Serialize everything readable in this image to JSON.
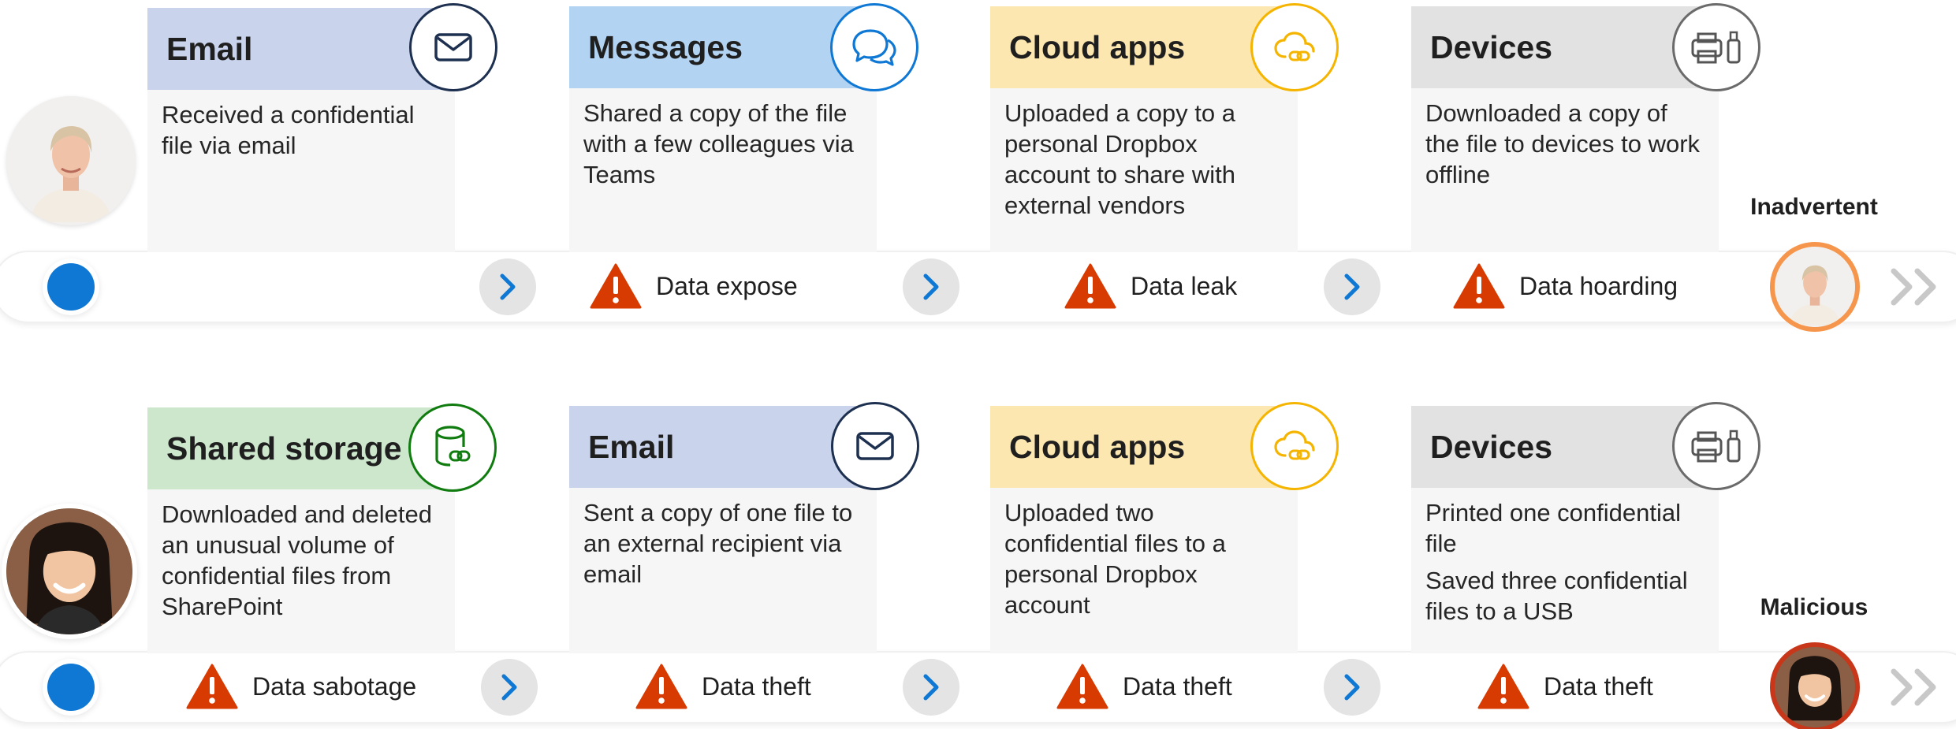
{
  "colors": {
    "email": "#c9d4ec",
    "messages": "#b3d3f2",
    "cloud": "#fde7b0",
    "devices": "#e2e2e2",
    "storage": "#cde7cd",
    "blue": "#0f78d4",
    "warning": "#d83b01",
    "inadvertent_ring": "#f6964d",
    "malicious_ring": "#c8371a"
  },
  "rows": [
    {
      "persona_label": "Inadvertent",
      "steps": [
        {
          "title": "Email",
          "icon": "envelope-icon",
          "lines": [
            "Received a confidential file via email"
          ]
        },
        {
          "title": "Messages",
          "icon": "chat-bubbles-icon",
          "lines": [
            "Shared a copy of the file with a few colleagues via Teams"
          ]
        },
        {
          "title": "Cloud apps",
          "icon": "cloud-link-icon",
          "lines": [
            "Uploaded a copy to a personal Dropbox account to share with external vendors"
          ]
        },
        {
          "title": "Devices",
          "icon": "printer-usb-icon",
          "lines": [
            "Downloaded a copy of the file to devices to work offline"
          ]
        }
      ],
      "risks": [
        "Data expose",
        "Data leak",
        "Data hoarding"
      ]
    },
    {
      "persona_label": "Malicious",
      "steps": [
        {
          "title": "Shared storage",
          "icon": "database-link-icon",
          "lines": [
            "Downloaded and deleted an unusual volume of confidential files from SharePoint"
          ]
        },
        {
          "title": "Email",
          "icon": "envelope-icon",
          "lines": [
            "Sent a copy of one file to an external recipient via email"
          ]
        },
        {
          "title": "Cloud apps",
          "icon": "cloud-link-icon",
          "lines": [
            "Uploaded two confidential files to a personal Dropbox account"
          ]
        },
        {
          "title": "Devices",
          "icon": "printer-usb-icon",
          "lines": [
            "Printed one confidential file",
            "Saved three confidential files to a USB"
          ]
        }
      ],
      "risks": [
        "Data sabotage",
        "Data theft",
        "Data theft",
        "Data theft"
      ]
    }
  ]
}
